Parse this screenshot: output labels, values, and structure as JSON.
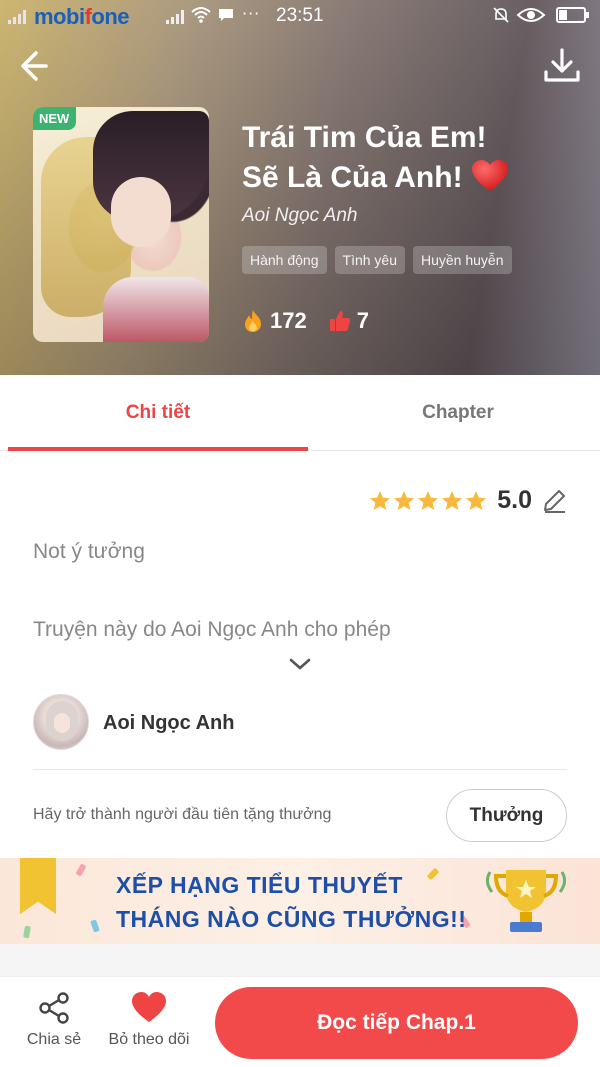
{
  "statusbar": {
    "carrier_part1": "mobi",
    "carrier_part2": "f",
    "carrier_part3": "one",
    "dots": "···",
    "time": "23:51"
  },
  "header": {
    "new_badge": "NEW",
    "title_line1": "Trái Tim Của Em!",
    "title_line2": "Sẽ Là Của Anh!",
    "author": "Aoi Ngọc Anh",
    "tags": [
      "Hành động",
      "Tình yêu",
      "Huyền huyễn"
    ],
    "views": "172",
    "likes": "7"
  },
  "tabs": {
    "detail": "Chi tiết",
    "chapter": "Chapter"
  },
  "detail": {
    "rating_value": "5.0",
    "rating_stars": 5,
    "description_line1": "Not ý tưởng",
    "description_line2": "Truyện này do Aoi Ngọc Anh cho phép",
    "author_name": "Aoi Ngọc Anh",
    "reward_prompt": "Hãy trở thành người đầu tiên tặng thưởng",
    "reward_button": "Thưởng"
  },
  "banner": {
    "line1": "XẾP HẠNG TIỂU THUYẾT",
    "line2": "THÁNG NÀO CŨNG THƯỞNG!!"
  },
  "bottom": {
    "share_label": "Chia sẻ",
    "unfollow_label": "Bỏ theo dõi",
    "read_button": "Đọc tiếp Chap.1"
  },
  "colors": {
    "accent": "#ef4444",
    "new_badge": "#3cb371",
    "star": "#f6b93b",
    "banner_text": "#1d4fa8"
  },
  "icons": [
    "back-arrow-icon",
    "download-icon",
    "fire-icon",
    "thumbs-up-icon",
    "star-icon",
    "edit-icon",
    "chevron-down-icon",
    "share-icon",
    "heart-icon",
    "trophy-icon"
  ]
}
